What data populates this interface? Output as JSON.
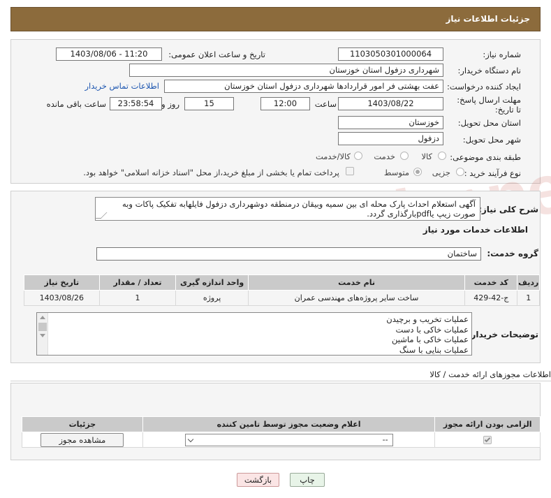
{
  "header_title": "جزئیات اطلاعات نیاز",
  "form": {
    "need_number_label": "شماره نیاز:",
    "need_number": "1103050301000064",
    "announce_label": "تاریخ و ساعت اعلان عمومی:",
    "announce_value": "1403/08/06 - 11:20",
    "buyer_label": "نام دستگاه خریدار:",
    "buyer_value": "شهرداری دزفول استان خوزستان",
    "creator_label": "ایجاد کننده درخواست:",
    "creator_value": "عفت بهشتی فر امور قراردادها شهرداری دزفول استان خوزستان",
    "contact_link": "اطلاعات تماس خریدار",
    "deadline_label": "مهلت ارسال پاسخ: تا تاریخ:",
    "deadline_date": "1403/08/22",
    "time_label": "ساعت",
    "deadline_time": "12:00",
    "days_value": "15",
    "days_label": "روز و",
    "remaining_time": "23:58:54",
    "remaining_label": "ساعت باقی مانده",
    "province_label": "استان محل تحویل:",
    "province_value": "خوزستان",
    "city_label": "شهر محل تحویل:",
    "city_value": "دزفول",
    "category_label": "طبقه بندی موضوعی:",
    "category_options": [
      "کالا",
      "خدمت",
      "کالا/خدمت"
    ],
    "process_label": "نوع فرآیند خرید :",
    "process_options": [
      "جزیی",
      "متوسط"
    ],
    "payment_text": "پرداخت تمام یا بخشی از مبلغ خرید،از محل \"اسناد خزانه اسلامی\" خواهد بود."
  },
  "description": {
    "label": "شرح کلی نیاز:",
    "text": "آگهی استعلام احداث پارک محله ای بین سمیه وبیقان درمنطقه دوشهرداری دزفول فایلهابه تفکیک پاکات وبه صورت زیپ یاpdfبارگذاری گردد."
  },
  "services": {
    "section_title": "اطلاعات خدمات مورد نیاز",
    "group_label": "گروه خدمت:",
    "group_value": "ساختمان",
    "table_headers": [
      "ردیف",
      "کد خدمت",
      "نام خدمت",
      "واحد اندازه گیری",
      "تعداد / مقدار",
      "تاریخ نیاز"
    ],
    "rows": [
      {
        "index": "1",
        "code": "ج-42-429",
        "name": "ساخت سایر پروژه‌های مهندسی عمران",
        "unit": "پروژه",
        "qty": "1",
        "date": "1403/08/26"
      }
    ]
  },
  "buyer_notes": {
    "label": "توضیحات خریدار:",
    "lines": [
      "عملیات تخریب و برچیدن",
      "عملیات خاکی با دست",
      "عملیات خاکی با ماشین",
      "عملیات بنایی با سنگ"
    ]
  },
  "permits": {
    "section_title": "اطلاعات مجوزهای ارائه خدمت / کالا",
    "headers": [
      "الزامی بودن ارائه مجوز",
      "اعلام وضعیت مجوز توسط تامین کننده",
      "جزئیات"
    ],
    "select_value": "--",
    "view_button": "مشاهده مجوز"
  },
  "buttons": {
    "print": "چاپ",
    "back": "بازگشت"
  },
  "watermark": "AriaTender.net"
}
